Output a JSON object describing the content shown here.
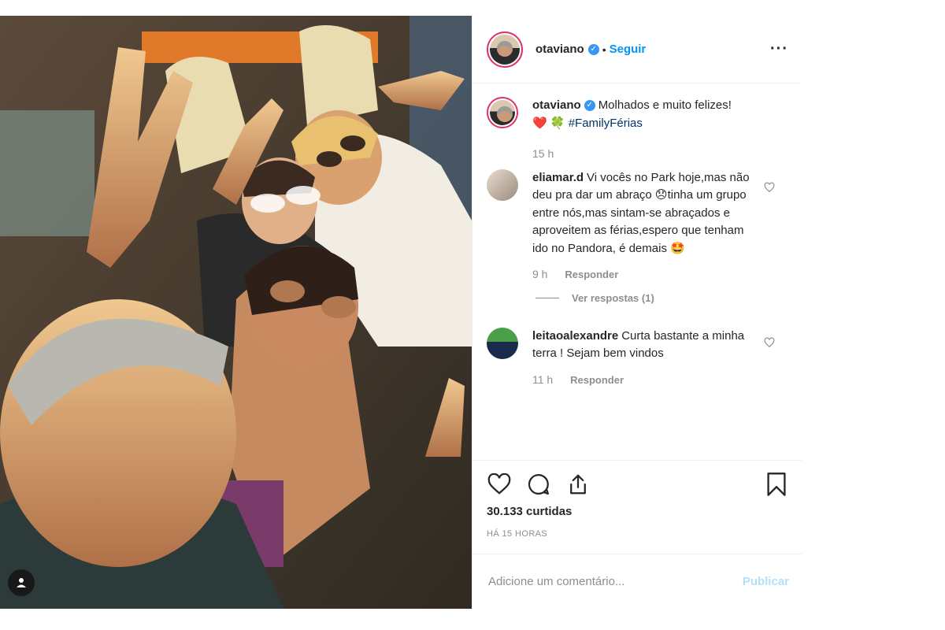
{
  "post": {
    "username": "otaviano",
    "verified": true,
    "dot": "•",
    "follow_label": "Seguir",
    "more_label": "···",
    "caption": {
      "text": "Molhados e muito felizes!",
      "emojis": "❤️ 🍀",
      "hashtag": "#FamilyFérias",
      "time": "15 h"
    },
    "likes": "30.133 curtidas",
    "posted_time": "HÁ 15 HORAS"
  },
  "comments": [
    {
      "username": "eliamar.d",
      "text": "Vi vocês no Park hoje,mas não deu pra dar um abraço 😞tinha um grupo entre nós,mas sintam-se abraçados e aproveitem as férias,espero que tenham ido no Pandora, é demais 🤩",
      "time": "9 h",
      "reply_label": "Responder",
      "view_replies": "Ver respostas (1)"
    },
    {
      "username": "leitaoalexandre",
      "text": "Curta bastante a minha terra ! Sejam bem vindos",
      "time": "11 h",
      "reply_label": "Responder"
    }
  ],
  "add_comment": {
    "placeholder": "Adicione um comentário...",
    "publish_label": "Publicar"
  },
  "icons": {
    "like": "heart-icon",
    "comment": "comment-icon",
    "share": "share-icon",
    "save": "bookmark-icon",
    "tag": "user-tag-icon"
  },
  "colors": {
    "accent_blue": "#0095f6",
    "verified_blue": "#3897f0",
    "hashtag": "#003569",
    "muted": "#8e8e8e",
    "publish_disabled": "#b2dffc",
    "text": "#262626"
  }
}
